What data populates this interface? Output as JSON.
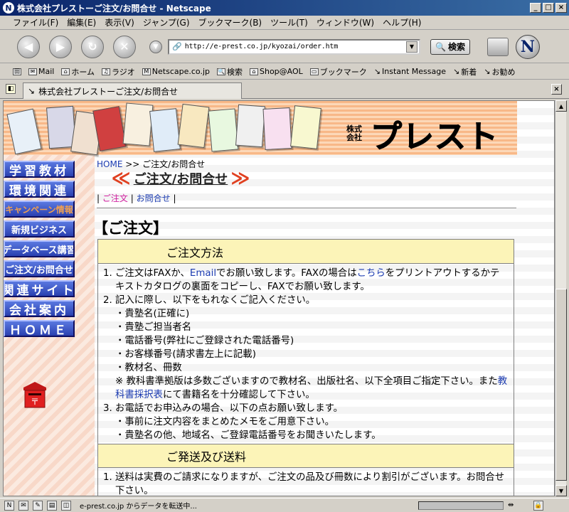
{
  "window": {
    "title": "株式会社プレストーご注文/お問合せ - Netscape",
    "minimize": "_",
    "maximize": "□",
    "close": "×"
  },
  "menu": [
    "ファイル(F)",
    "編集(E)",
    "表示(V)",
    "ジャンプ(G)",
    "ブックマーク(B)",
    "ツール(T)",
    "ウィンドウ(W)",
    "ヘルプ(H)"
  ],
  "nav": {
    "url": "http://e-prest.co.jp/kyozai/order.htm",
    "search_label": "検索"
  },
  "personal_toolbar": [
    "Mail",
    "ホーム",
    "ラジオ",
    "Netscape.co.jp",
    "検索",
    "Shop@AOL",
    "ブックマーク",
    "Instant Message",
    "新着",
    "お勧め"
  ],
  "tab": {
    "title": "株式会社プレストーご注文/お問合せ"
  },
  "page": {
    "logo_kabu": "株式会社",
    "logo_name": "プレスト",
    "left_menu": [
      "学習教材",
      "環境関連",
      "キャンペーン情報",
      "新規ビジネス",
      "データベース講習",
      "ご注文/お問合せ",
      "関連サイト",
      "会社案内",
      "ＨＯＭＥ"
    ],
    "breadcrumb_home": "HOME",
    "breadcrumb_rest": " >> ご注文/お問合せ",
    "title": "ご注文/お問合せ",
    "sublink_order": "ご注文",
    "sublink_inquiry": "お問合せ",
    "section_title": "【ご注文】",
    "table_head_1": "ご注文方法",
    "item1_a": "ご注文はFAXか、",
    "item1_email": "Email",
    "item1_b": "でお願い致します。FAXの場合は",
    "item1_here": "こちら",
    "item1_c": "をプリントアウトするかテキストカタログの裏面をコピーし、FAXでお願い致します。",
    "item2": "記入に際し、以下をもれなくご記入ください。",
    "item2_subs": [
      "・貴塾名(正確に)",
      "・貴塾ご担当者名",
      "・電話番号(弊社にご登録された電話番号)",
      "・お客様番号(請求書左上に記載)",
      "・教材名、冊数"
    ],
    "item2_note_a": "※ 教科書準拠版は多数ございますので教材名、出版社名、以下全項目ご指定下さい。また",
    "item2_note_link": "教科書採択表",
    "item2_note_b": "にて書籍名を十分確認して下さい。",
    "item3": "お電話でお申込みの場合、以下の点お願い致します。",
    "item3_subs": [
      "・事前に注文内容をまとめたメモをご用意下さい。",
      "・貴塾名の他、地域名、ご登録電話番号をお聞きいたします。"
    ],
    "table_head_2": "ご発送及び送料",
    "item4": "送料は実費のご請求になりますが、ご注文の品及び冊数により割引がございます。お問合せ下さい。"
  },
  "status": {
    "text": "e-prest.co.jp からデータを転送中..."
  }
}
